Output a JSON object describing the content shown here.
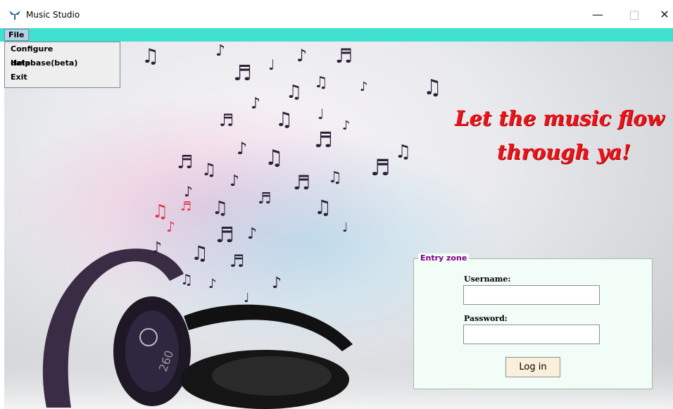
{
  "window": {
    "title": "Music Studio",
    "minimize": "—",
    "maximize": "□",
    "close": "✕"
  },
  "menu": {
    "file": "File",
    "items": [
      "Configure database(beta)",
      "Help",
      "Exit"
    ]
  },
  "slogan": {
    "line1": "Let the music flow",
    "line2": "through ya!"
  },
  "entry_zone": {
    "legend": "Entry zone",
    "username_label": "Username:",
    "password_label": "Password:",
    "username_value": "",
    "password_value": "",
    "login_button": "Log in"
  },
  "colors": {
    "menubar": "#40e0d0",
    "slogan": "#e8141a",
    "legend": "#800080",
    "panel": "#f3fdf8",
    "button": "#fbefd9"
  }
}
